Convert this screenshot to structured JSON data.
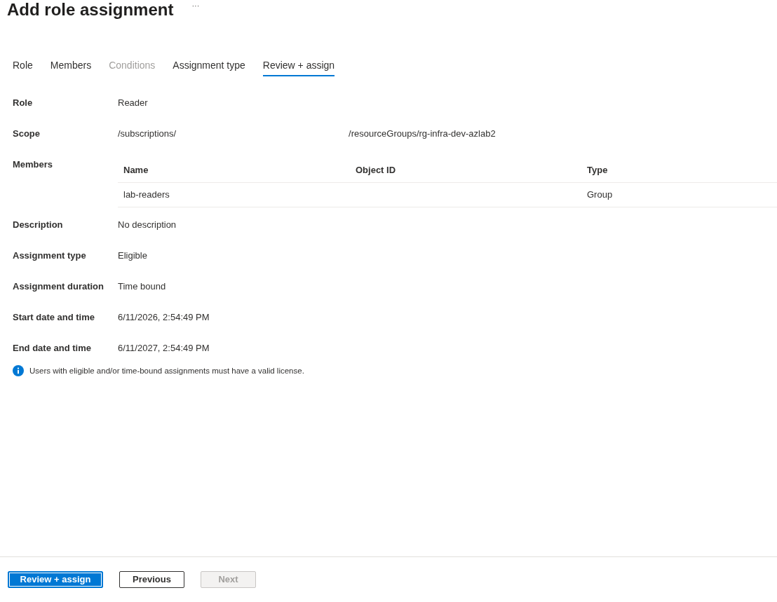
{
  "header": {
    "title": "Add role assignment",
    "more_button": "···"
  },
  "tabs": [
    {
      "label": "Role",
      "selected": false,
      "disabled": false
    },
    {
      "label": "Members",
      "selected": false,
      "disabled": false
    },
    {
      "label": "Conditions",
      "selected": false,
      "disabled": true
    },
    {
      "label": "Assignment type",
      "selected": false,
      "disabled": false
    },
    {
      "label": "Review + assign",
      "selected": true,
      "disabled": false
    }
  ],
  "details": [
    {
      "kind": "text",
      "label": "Role",
      "value": "Reader"
    },
    {
      "kind": "scope",
      "label": "Scope",
      "parts": [
        "/subscriptions/",
        "/resourceGroups/rg-infra-dev-azlab2"
      ]
    },
    {
      "kind": "table",
      "label": "Members",
      "table": {
        "columns": [
          "Name",
          "Object ID",
          "Type"
        ],
        "rows": [
          {
            "cells": [
              "lab-readers",
              null,
              "Group"
            ]
          }
        ]
      }
    },
    {
      "kind": "text",
      "label": "Description",
      "value": "No description"
    },
    {
      "kind": "text",
      "label": "Assignment type",
      "value": "Eligible"
    },
    {
      "kind": "text",
      "label": "Assignment duration",
      "value": "Time bound"
    },
    {
      "kind": "text",
      "label": "Start date and time",
      "value": "6/11/2026, 2:54:49 PM"
    },
    {
      "kind": "text",
      "label": "End date and time",
      "value": "6/11/2027, 2:54:49 PM"
    }
  ],
  "info_note": {
    "text": "Users with eligible and/or time-bound assignments must have a valid license."
  },
  "footer_buttons": [
    {
      "label": "Review + assign",
      "kind": "primary",
      "disabled": false,
      "focused": true
    },
    {
      "label": "Previous",
      "kind": "secondary",
      "disabled": false,
      "focused": false
    },
    {
      "label": "Next",
      "kind": "secondary",
      "disabled": true,
      "focused": false
    }
  ]
}
